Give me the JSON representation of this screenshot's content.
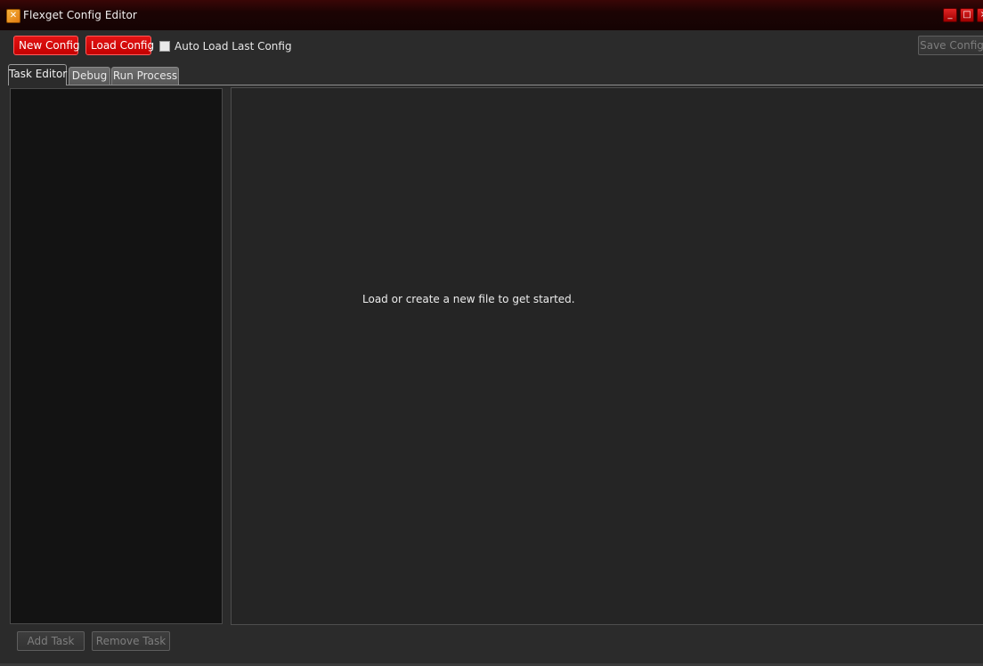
{
  "window": {
    "title": "Flexget Config Editor",
    "app_icon": "flexget-icon",
    "controls": {
      "minimize_glyph": "_",
      "maximize_glyph": "□",
      "close_glyph": "×"
    }
  },
  "toolbar": {
    "new_config_label": "New Config",
    "load_config_label": "Load Config",
    "auto_load_label": "Auto Load Last Config",
    "auto_load_checked": false,
    "save_config_label": "Save Config"
  },
  "tabs": [
    {
      "label": "Task Editor",
      "active": true
    },
    {
      "label": "Debug",
      "active": false
    },
    {
      "label": "Run Process",
      "active": false
    }
  ],
  "editor": {
    "placeholder": "Load or create a new file to get started."
  },
  "task_buttons": {
    "add_task_label": "Add Task",
    "remove_task_label": "Remove Task"
  },
  "colors": {
    "accent_red": "#d40000",
    "background": "#2b2b2b",
    "task_list_bg": "#131313",
    "editor_bg": "#252525"
  }
}
